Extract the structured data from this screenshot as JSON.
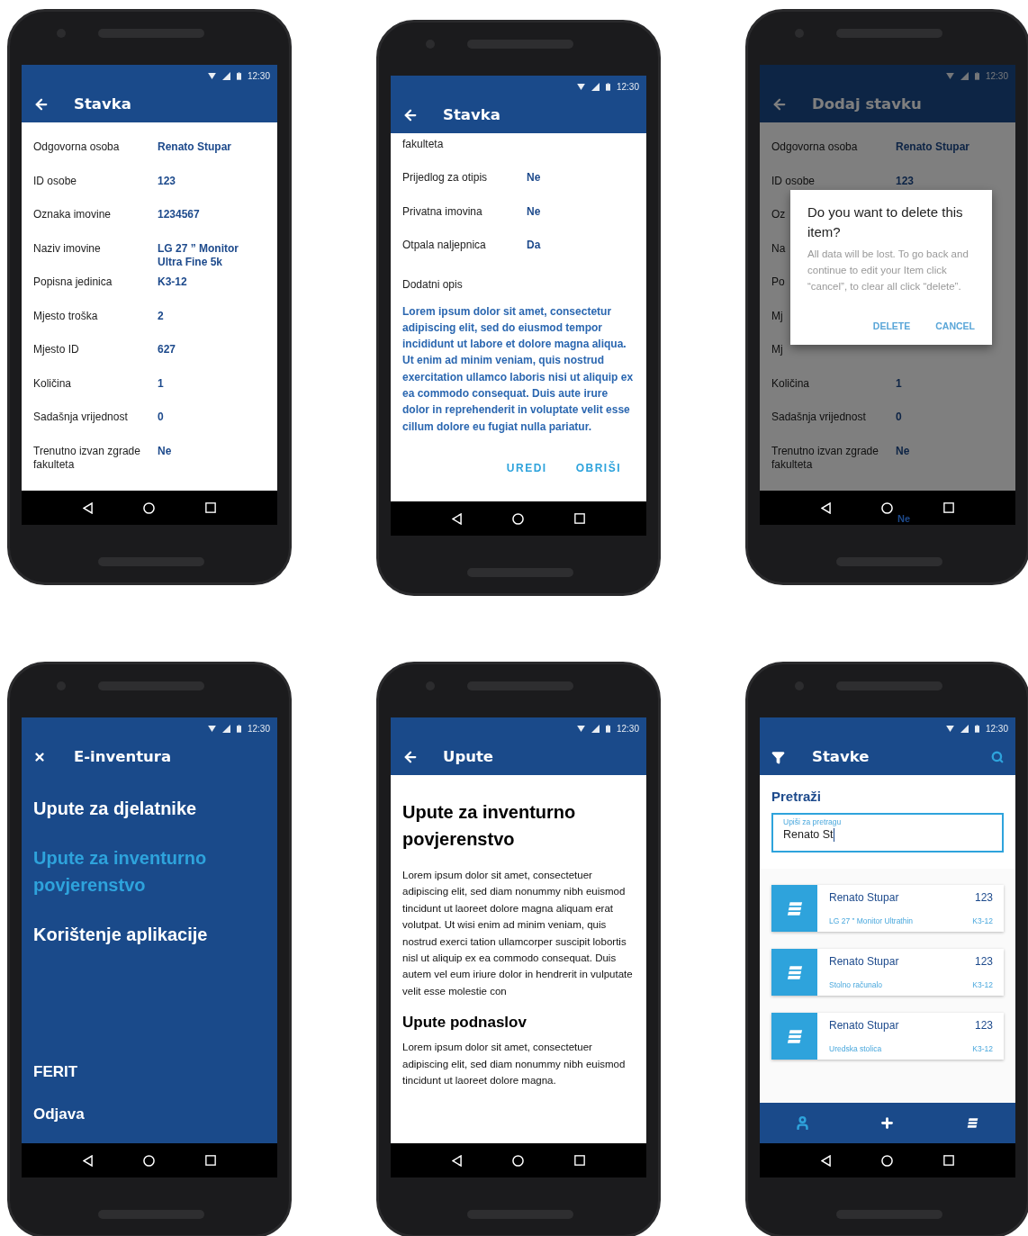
{
  "phones": [
    {
      "kind": "details",
      "status_time": "12:30",
      "title": "Stavka",
      "rows": [
        {
          "label": "Odgovorna osoba",
          "value": "Renato Stupar"
        },
        {
          "label": "ID osobe",
          "value": "123"
        },
        {
          "label": "Oznaka imovine",
          "value": "1234567"
        },
        {
          "label": "Naziv imovine",
          "value": "LG 27 ” Monitor Ultra Fine 5k"
        },
        {
          "label": "Popisna jedinica",
          "value": "K3-12"
        },
        {
          "label": "Mjesto troška",
          "value": "2"
        },
        {
          "label": "Mjesto ID",
          "value": "627"
        },
        {
          "label": "Količina",
          "value": "1"
        },
        {
          "label": "Sadašnja vrijednost",
          "value": "0"
        },
        {
          "label": "Trenutno izvan zgrade fakulteta",
          "value": "Ne"
        }
      ]
    },
    {
      "kind": "details",
      "status_time": "12:30",
      "title": "Stavka",
      "head_text": "fakulteta",
      "rows": [
        {
          "label": "Prijedlog za otipis",
          "value": "Ne"
        },
        {
          "label": "Privatna imovina",
          "value": "Ne"
        },
        {
          "label": "Otpala naljepnica",
          "value": "Da"
        }
      ],
      "description_label": "Dodatni opis",
      "description": "Lorem ipsum dolor sit amet, consectetur adipiscing elit, sed do eiusmod tempor incididunt ut labore et dolore magna aliqua. Ut enim ad minim veniam, quis nostrud exercitation ullamco laboris nisi ut aliquip ex ea commodo consequat. Duis aute irure dolor in reprehenderit in voluptate velit esse cillum dolore eu fugiat nulla pariatur.",
      "actions": [
        "UREDI",
        "OBRIŠI"
      ]
    },
    {
      "kind": "details",
      "status_time": "12:30",
      "title": "Dodaj stavku",
      "rows": [
        {
          "label": "Odgovorna osoba",
          "value": "Renato Stupar"
        },
        {
          "label": "ID osobe",
          "value": "123"
        },
        {
          "label": "Oz"
        },
        {
          "label": "Na"
        },
        {
          "label": "Po"
        },
        {
          "label": "Mj"
        },
        {
          "label": "Mj"
        },
        {
          "label": "Količina",
          "value": "1"
        },
        {
          "label": "Sadašnja vrijednost",
          "value": "0"
        },
        {
          "label": "Trenutno izvan zgrade fakulteta",
          "value": "Ne"
        }
      ],
      "dialog": {
        "title": "Do you want to delete this item?",
        "message": "All data will be lost. To go back and continue to edit your Item click “cancel”, to clear all click “delete”.",
        "buttons": [
          "DELETE",
          "CANCEL"
        ]
      },
      "overflow_text": "Ne"
    },
    {
      "kind": "menu",
      "status_time": "12:30",
      "title": "E-inventura",
      "items": [
        {
          "label": "Upute za djelatnike",
          "selected": false
        },
        {
          "label": "Upute za inventurno povjerenstvo",
          "selected": true
        },
        {
          "label": "Korištenje aplikacije",
          "selected": false
        }
      ],
      "footer_items": [
        "FERIT",
        "Odjava"
      ]
    },
    {
      "kind": "article",
      "status_time": "12:30",
      "title": "Upute",
      "blocks": [
        {
          "kind": "heading",
          "text": "Upute za inventurno povjerenstvo"
        },
        {
          "kind": "paragraph",
          "text": "Lorem ipsum dolor sit amet, consectetuer adipiscing elit, sed diam nonummy nibh euismod tincidunt ut laoreet dolore magna aliquam erat volutpat. Ut wisi enim ad minim veniam, quis nostrud exerci tation ullamcorper suscipit lobortis nisl ut aliquip ex ea commodo consequat. Duis autem vel eum iriure dolor in hendrerit in vulputate velit esse molestie con"
        },
        {
          "kind": "subheading",
          "text": "Upute podnaslov"
        },
        {
          "kind": "paragraph",
          "text": "Lorem ipsum dolor sit amet, consectetuer adipiscing elit, sed diam nonummy nibh euismod tincidunt ut laoreet dolore magna."
        }
      ]
    },
    {
      "kind": "list",
      "status_time": "12:30",
      "title": "Stavke",
      "search_title": "Pretraži",
      "field": {
        "label": "Upiši za pretragu",
        "value": "Renato St"
      },
      "cards": [
        {
          "name": "Renato Stupar",
          "number": "123",
          "subtitle": "LG 27 ” Monitor Ultrathin",
          "code": "K3-12"
        },
        {
          "name": "Renato Stupar",
          "number": "123",
          "subtitle": "Stolno računalo",
          "code": "K3-12"
        },
        {
          "name": "Renato Stupar",
          "number": "123",
          "subtitle": "Uredska stolica",
          "code": "K3-12"
        }
      ],
      "bottom_tabs": [
        {
          "kind": "person",
          "selected": true
        },
        {
          "kind": "add",
          "selected": false
        },
        {
          "kind": "list",
          "selected": false
        }
      ]
    }
  ]
}
